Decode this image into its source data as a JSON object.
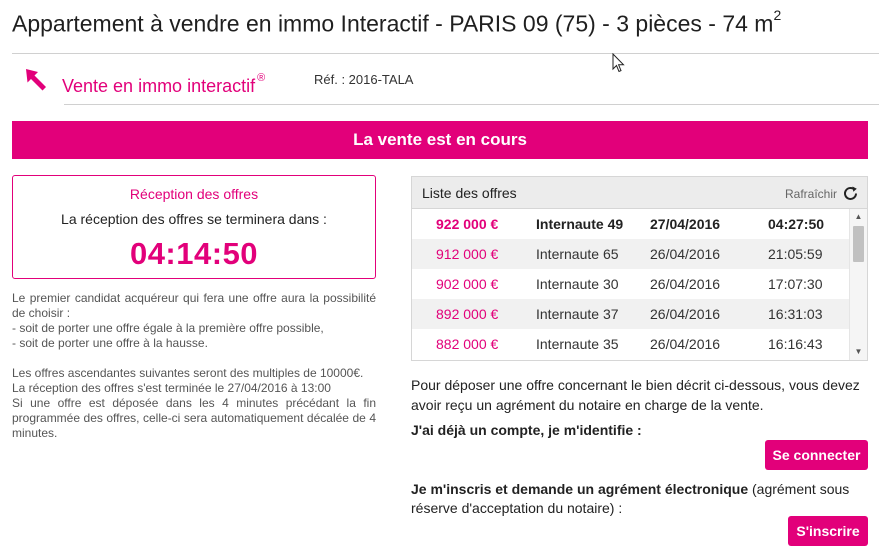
{
  "header": {
    "title": "Appartement à vendre en immo Interactif - PARIS 09 (75) - 3 pièces - 74 m",
    "title_sup": "2"
  },
  "brand": {
    "name": "Vente en immo interactif",
    "reg_mark": "®",
    "reference": "Réf. : 2016-TALA",
    "icon": "arrow-logo-icon"
  },
  "banner": {
    "text": "La vente est en cours"
  },
  "reception": {
    "title": "Réception des offres",
    "subtitle": "La réception des offres se terminera dans :",
    "countdown": "04:14:50"
  },
  "rules": {
    "line1": "Le premier candidat acquéreur qui fera une offre aura la possibilité de choisir :",
    "line2": "- soit de porter une offre égale à la première offre possible,",
    "line3": "- soit de porter une offre à la hausse.",
    "line4": "Les offres ascendantes suivantes seront des multiples de 10000€.",
    "line5": "La réception des offres s'est terminée le 27/04/2016 à 13:00",
    "line6": "Si une offre est déposée dans les 4 minutes précédant la fin programmée des offres, celle-ci sera automatiquement décalée de 4 minutes."
  },
  "offers_list": {
    "title": "Liste des offres",
    "refresh_label": "Rafraîchir",
    "rows": [
      {
        "price": "922 000 €",
        "user": "Internaute 49",
        "date": "27/04/2016",
        "time": "04:27:50"
      },
      {
        "price": "912 000 €",
        "user": "Internaute 65",
        "date": "26/04/2016",
        "time": "21:05:59"
      },
      {
        "price": "902 000 €",
        "user": "Internaute 30",
        "date": "26/04/2016",
        "time": "17:07:30"
      },
      {
        "price": "892 000 €",
        "user": "Internaute 37",
        "date": "26/04/2016",
        "time": "16:31:03"
      },
      {
        "price": "882 000 €",
        "user": "Internaute 35",
        "date": "26/04/2016",
        "time": "16:16:43"
      }
    ]
  },
  "deposit": {
    "text": "Pour déposer une offre concernant le bien décrit ci-dessous, vous devez avoir reçu un agrément du notaire en charge de la vente.",
    "account_text": "J'ai déjà un compte, je m'identifie :",
    "connect_label": "Se connecter",
    "register_bold": "Je m'inscris et demande un agrément électronique",
    "register_rest": " (agrément sous réserve d'acceptation du notaire) :",
    "register_label": "S'inscrire"
  },
  "colors": {
    "accent": "#e2007a",
    "text": "#222222",
    "muted": "#555555",
    "row_alt": "#f1f1f1"
  }
}
